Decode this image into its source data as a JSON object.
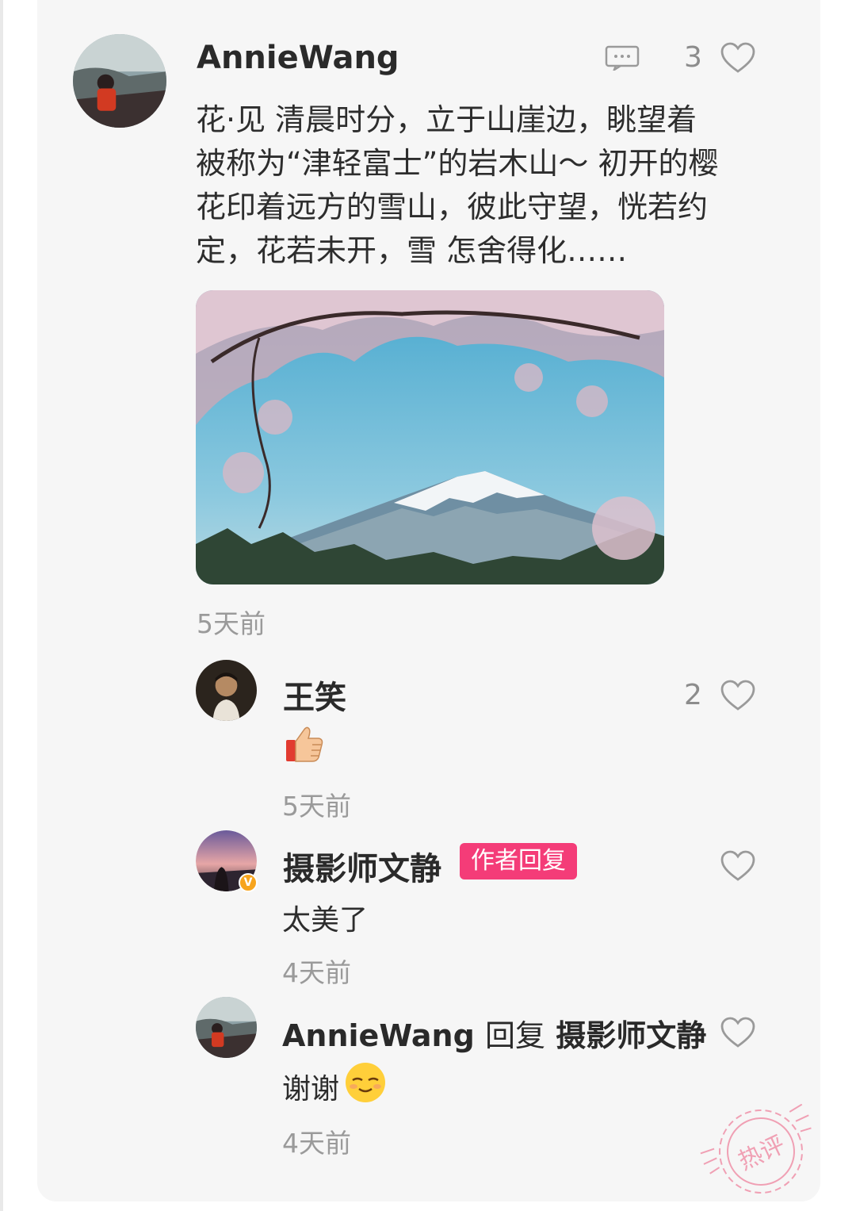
{
  "main_comment": {
    "username": "AnnieWang",
    "text": "花·见 清晨时分，立于山崖边，眺望着被称为“津轻富士”的岩木山～ 初开的樱花印着远方的雪山，彼此守望，恍若约定，花若未开，雪 怎舍得化……",
    "line1": "花·见 清晨时分，立于山崖边，眺望着",
    "line2": "被称为“津轻富士”的岩木山～ 初开的樱",
    "line3": "花印着远方的雪山，彼此守望，恍若约",
    "line4": "定，花若未开，雪 怎舍得化……",
    "like_count": "3",
    "time": "5天前",
    "icons": {
      "menu": "comment-menu-icon",
      "like": "heart-icon"
    }
  },
  "replies": [
    {
      "username": "王笑",
      "text": "👍",
      "like_count": "2",
      "time": "5天前"
    },
    {
      "username": "摄影师文静",
      "badge": "作者回复",
      "text": "太美了",
      "time": "4天前",
      "verified": "V"
    },
    {
      "username": "AnnieWang",
      "reply_word": "回复",
      "reply_to": "摄影师文静",
      "text": "谢谢",
      "time": "4天前"
    }
  ],
  "stamp": {
    "text": "热评"
  },
  "colors": {
    "badge": "#f43c78",
    "card_bg": "#f6f6f6",
    "time": "#9a9a9a"
  }
}
